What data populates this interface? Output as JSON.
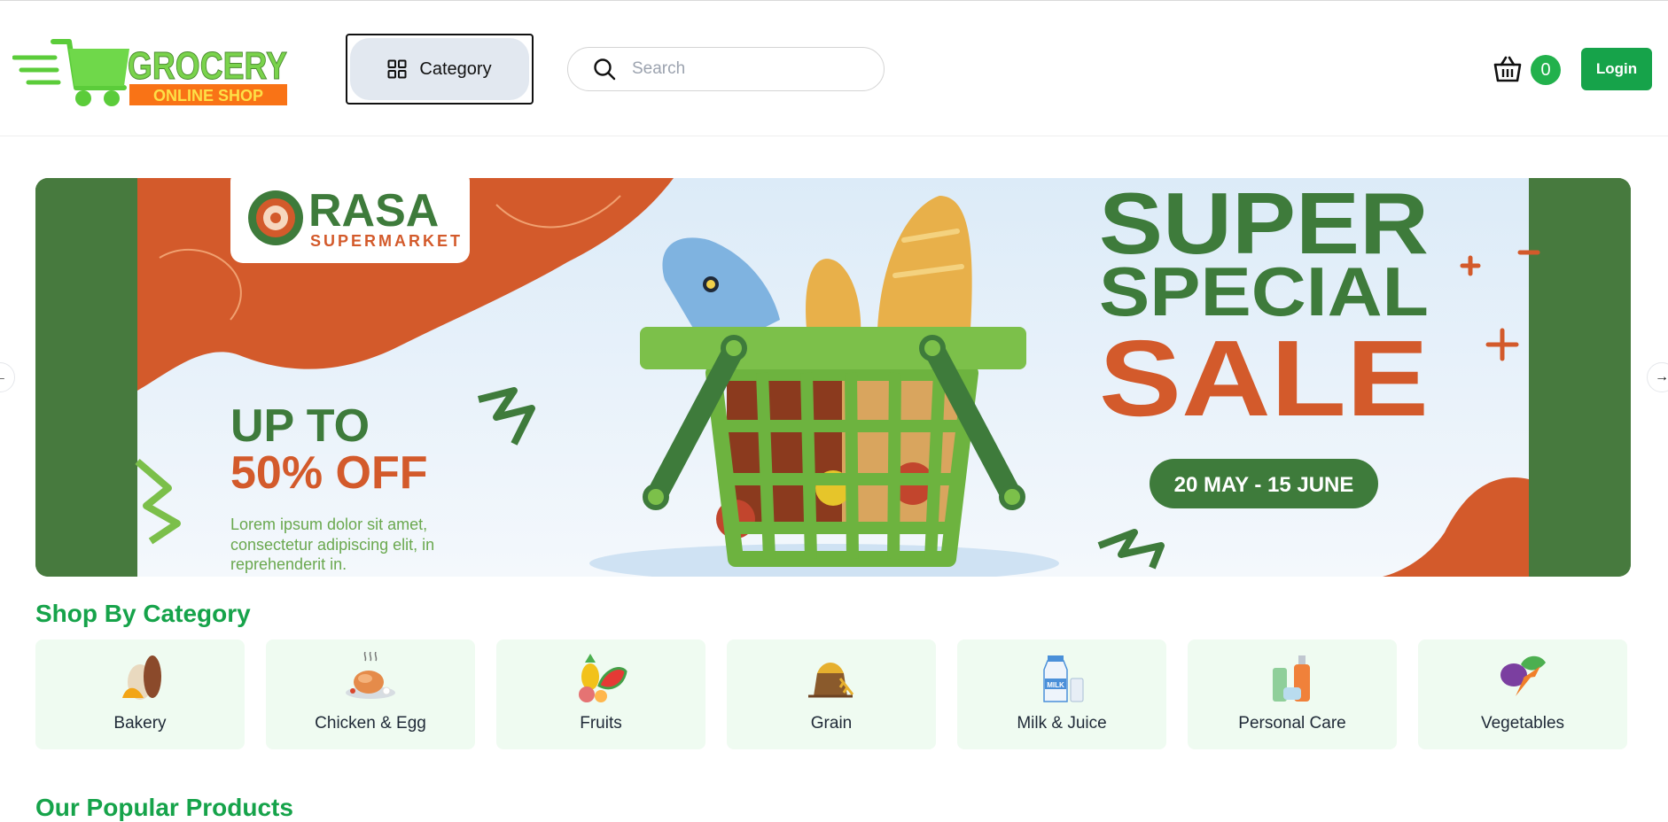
{
  "header": {
    "logo_text_top": "GROCERY",
    "logo_text_bottom": "ONLINE SHOP",
    "category_label": "Category",
    "search_placeholder": "Search",
    "cart_count": "0",
    "login_label": "Login"
  },
  "banner": {
    "brand_name": "RASA",
    "brand_sub": "SUPERMARKET",
    "headline_1": "SUPER",
    "headline_2": "SPECIAL",
    "headline_3": "SALE",
    "offer_1": "UP TO",
    "offer_2": "50% OFF",
    "body_1": "Lorem ipsum dolor sit amet,",
    "body_2": "consectetur adipiscing elit, in",
    "body_3": "reprehenderit in.",
    "date_range": "20 MAY - 15 JUNE"
  },
  "shop_by_category": {
    "title": "Shop By Category",
    "items": [
      {
        "label": "Bakery",
        "icon": "bread-icon"
      },
      {
        "label": "Chicken & Egg",
        "icon": "chicken-icon"
      },
      {
        "label": "Fruits",
        "icon": "fruits-icon"
      },
      {
        "label": "Grain",
        "icon": "grain-icon"
      },
      {
        "label": "Milk & Juice",
        "icon": "milk-icon"
      },
      {
        "label": "Personal Care",
        "icon": "personal-care-icon"
      },
      {
        "label": "Vegetables",
        "icon": "vegetables-icon"
      }
    ]
  },
  "popular_products": {
    "title": "Our Popular Products"
  },
  "colors": {
    "brand_green": "#16a34a",
    "banner_dark_green": "#477a3e",
    "banner_orange": "#d35a2b",
    "category_card_bg": "#effbf1"
  }
}
